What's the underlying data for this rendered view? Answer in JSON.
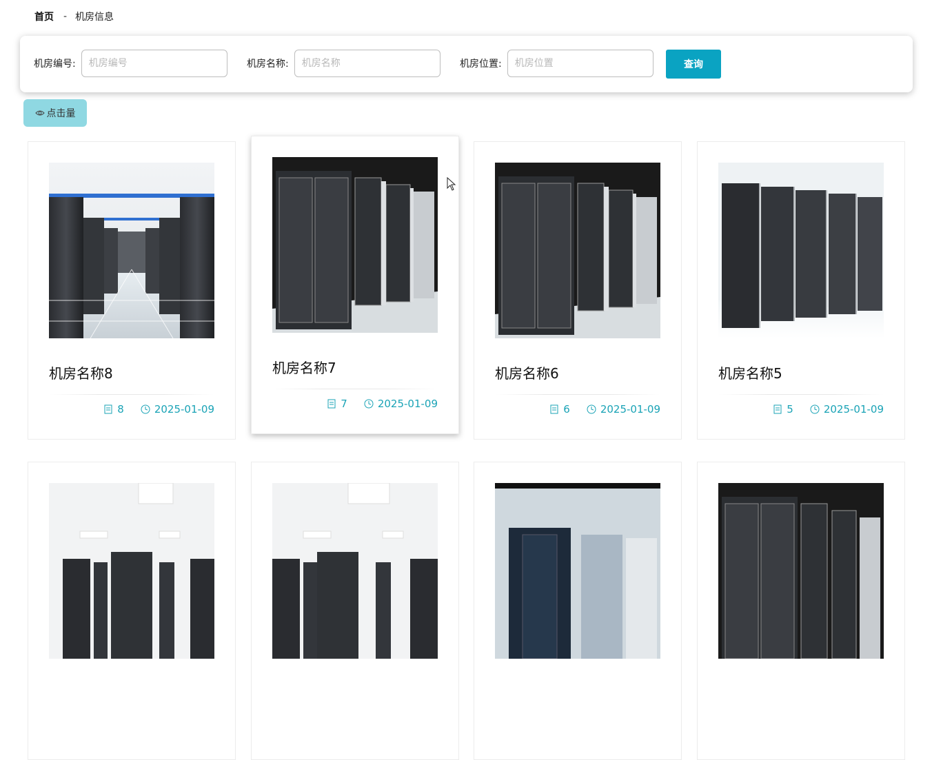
{
  "breadcrumb": {
    "home": "首页",
    "separator": "-",
    "current": "机房信息"
  },
  "search": {
    "fields": [
      {
        "label": "机房编号:",
        "placeholder": "机房编号",
        "value": ""
      },
      {
        "label": "机房名称:",
        "placeholder": "机房名称",
        "value": ""
      },
      {
        "label": "机房位置:",
        "placeholder": "机房位置",
        "value": ""
      }
    ],
    "query_label": "查询"
  },
  "clicks_button": {
    "label": "点击量",
    "icon": "eye-icon"
  },
  "cards": [
    {
      "title": "机房名称8",
      "count": "8",
      "date": "2025-01-09",
      "image": "corridor"
    },
    {
      "title": "机房名称7",
      "count": "7",
      "date": "2025-01-09",
      "image": "racks-dark"
    },
    {
      "title": "机房名称6",
      "count": "6",
      "date": "2025-01-09",
      "image": "racks-dark"
    },
    {
      "title": "机房名称5",
      "count": "5",
      "date": "2025-01-09",
      "image": "racks-bright"
    },
    {
      "title": "",
      "count": "",
      "date": "",
      "image": "hall-lights"
    },
    {
      "title": "",
      "count": "",
      "date": "",
      "image": "hall-lights"
    },
    {
      "title": "",
      "count": "",
      "date": "",
      "image": "blue-room"
    },
    {
      "title": "",
      "count": "",
      "date": "",
      "image": "racks-dark"
    }
  ],
  "colors": {
    "accent": "#0aa3c2",
    "meta_text": "#1aa3b6",
    "clicks_bg": "#8fd8e2"
  }
}
